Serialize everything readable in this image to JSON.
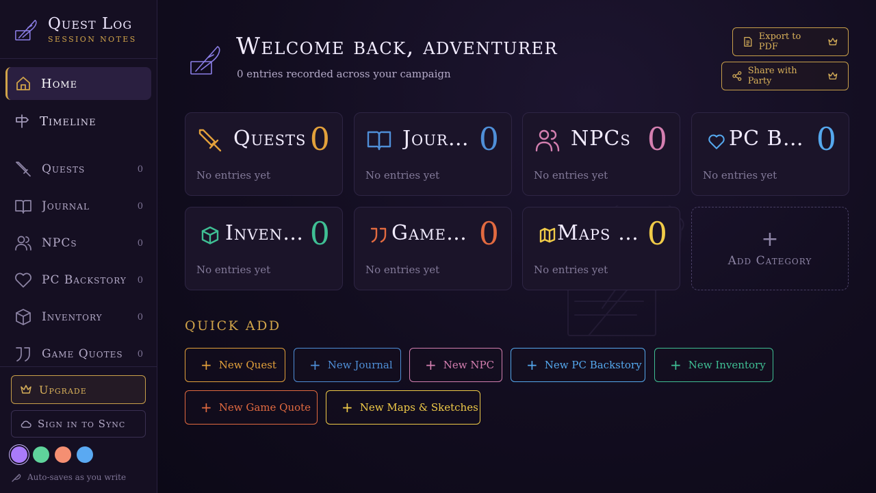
{
  "brand": {
    "title": "Quest Log",
    "subtitle": "Session Notes"
  },
  "nav": [
    {
      "label": "Home",
      "icon": "home-icon",
      "active": true
    },
    {
      "label": "Timeline",
      "icon": "signpost-icon",
      "active": false
    }
  ],
  "categories": [
    {
      "label": "Quests",
      "count": "0",
      "icon": "sword-icon",
      "color": "#e3a13b",
      "empty": "No entries yet"
    },
    {
      "label": "Journal",
      "count": "0",
      "icon": "book-icon",
      "color": "#4f8fd8",
      "empty": "No entries yet"
    },
    {
      "label": "NPCs",
      "count": "0",
      "icon": "users-icon",
      "color": "#d47fb0",
      "empty": "No entries yet"
    },
    {
      "label": "PC Backstory",
      "count": "0",
      "icon": "heart-icon",
      "color": "#55a8ee",
      "empty": "No entries yet"
    },
    {
      "label": "Inventory",
      "count": "0",
      "icon": "box-icon",
      "color": "#3fbf94",
      "empty": "No entries yet"
    },
    {
      "label": "Game Quotes",
      "count": "0",
      "icon": "quote-icon",
      "color": "#e26a40",
      "empty": "No entries yet"
    },
    {
      "label": "Maps & Sketches",
      "count": "0",
      "icon": "map-icon",
      "color": "#f0cb48",
      "empty": "No entries yet"
    }
  ],
  "sidebar_visible_categories": [
    {
      "label": "Quests",
      "count": "0"
    },
    {
      "label": "Journal",
      "count": "0"
    },
    {
      "label": "NPCs",
      "count": "0"
    },
    {
      "label": "PC Backstory",
      "count": "0"
    },
    {
      "label": "Inventory",
      "count": "0"
    },
    {
      "label": "Game Quotes",
      "count": "0"
    }
  ],
  "upgrade": {
    "label": "Upgrade"
  },
  "signin": {
    "label": "Sign in to Sync"
  },
  "theme_swatches": [
    "#a97bfa",
    "#5fd39b",
    "#f58f72",
    "#5aa9f2"
  ],
  "autosave": "Auto-saves as you write",
  "header": {
    "title": "Welcome back, adventurer",
    "subtitle": "0 entries recorded across your campaign"
  },
  "actions": {
    "export": "Export to PDF",
    "share": "Share with Party"
  },
  "add_category": "Add Category",
  "quick_add": {
    "title": "QUICK ADD",
    "buttons": [
      {
        "label": "New Quest",
        "color": "#e3a13b"
      },
      {
        "label": "New Journal",
        "color": "#4f8fd8"
      },
      {
        "label": "New NPC",
        "color": "#d47fb0"
      },
      {
        "label": "New PC Backstory",
        "color": "#55a8ee"
      },
      {
        "label": "New Inventory",
        "color": "#3fbf94"
      },
      {
        "label": "New Game Quote",
        "color": "#e26a40"
      },
      {
        "label": "New Maps & Sketches",
        "color": "#f0cb48"
      }
    ]
  }
}
